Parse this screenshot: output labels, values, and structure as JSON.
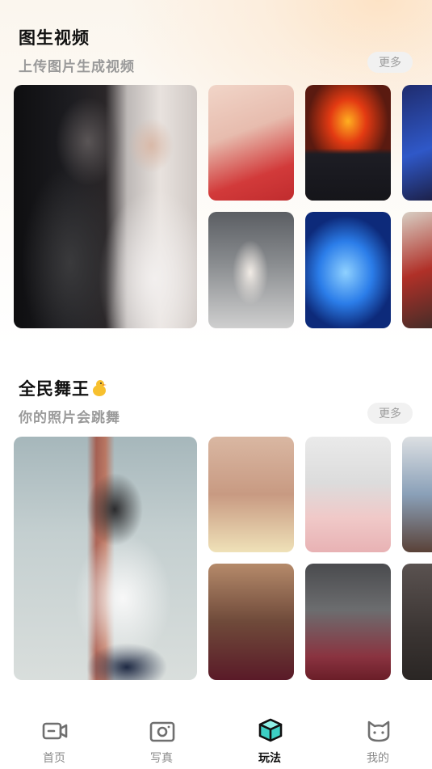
{
  "sections": [
    {
      "title": "图生视频",
      "subtitle": "上传图片生成视频",
      "more_label": "更多"
    },
    {
      "title": "全民舞王",
      "subtitle": "你的照片会跳舞",
      "more_label": "更多",
      "title_icon": "duck-emoji-icon"
    }
  ],
  "tabbar": {
    "items": [
      {
        "label": "首页",
        "icon": "video-camera-icon",
        "active": false
      },
      {
        "label": "写真",
        "icon": "camera-icon",
        "active": false
      },
      {
        "label": "玩法",
        "icon": "cube-icon",
        "active": true
      },
      {
        "label": "我的",
        "icon": "cat-face-icon",
        "active": false
      }
    ]
  },
  "colors": {
    "active_tab": "#111111",
    "inactive_tab": "#8a8a8a",
    "subtitle": "#9a9a9a",
    "more_bg": "#f1f1f1",
    "accent_teal": "#3ccfc4"
  }
}
